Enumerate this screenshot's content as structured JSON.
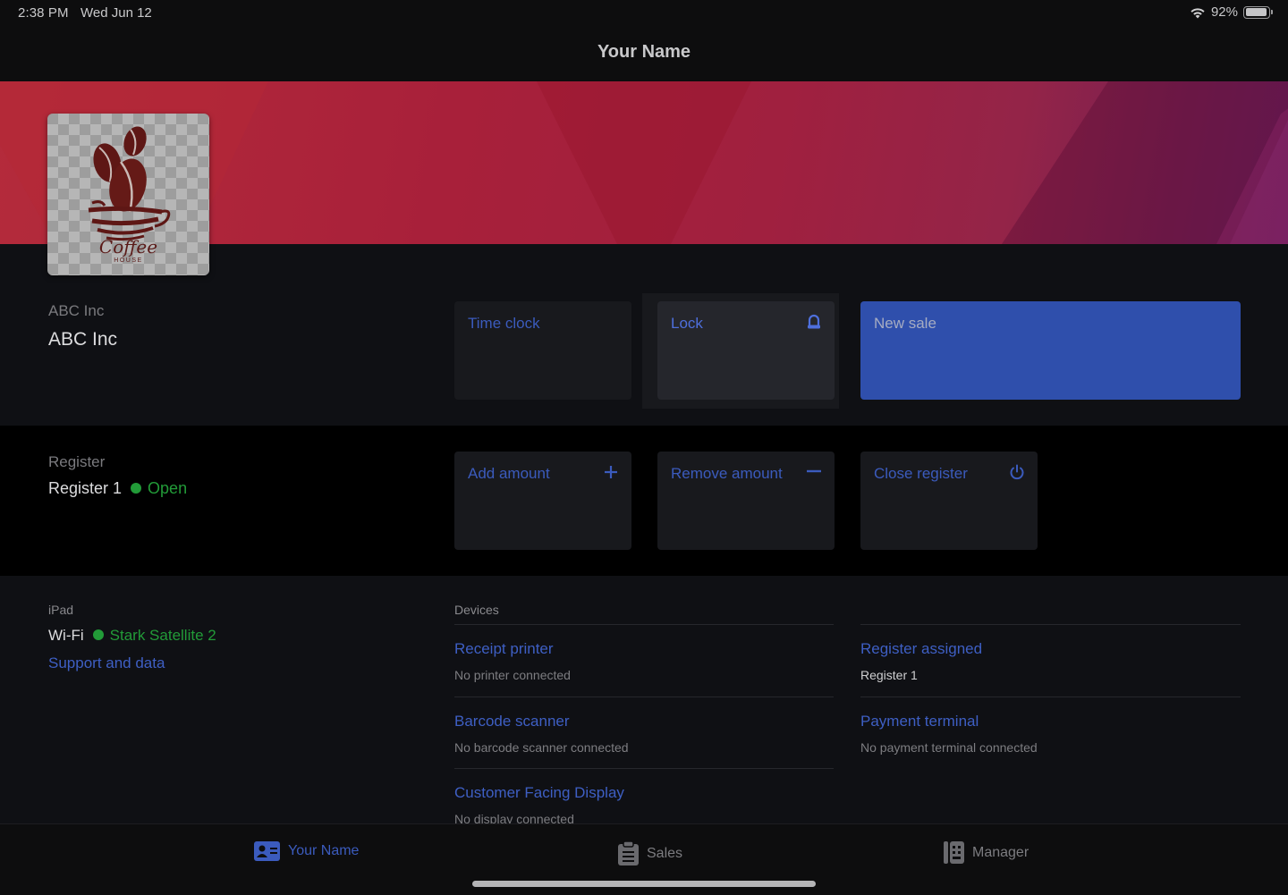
{
  "status_bar": {
    "time": "2:38 PM",
    "date": "Wed Jun 12",
    "wifi_icon": "wifi-icon",
    "battery_percent": "92%",
    "battery_level": 0.92,
    "battery_icon": "battery-icon"
  },
  "nav": {
    "title": "Your Name"
  },
  "logo": {
    "wordmark": "Coffee",
    "subtitle": "HOUSE"
  },
  "business": {
    "label": "ABC Inc",
    "name": "ABC Inc"
  },
  "actions": {
    "time_clock": "Time clock",
    "lock": "Lock",
    "lock_icon": "lock-icon",
    "new_sale": "New sale"
  },
  "register": {
    "label": "Register",
    "name": "Register 1",
    "status": "Open",
    "status_color": "#229b38",
    "actions": {
      "add_amount": "Add amount",
      "add_icon": "plus-icon",
      "remove_amount": "Remove amount",
      "remove_icon": "minus-icon",
      "close_register": "Close register",
      "close_icon": "power-icon"
    }
  },
  "device": {
    "label": "iPad",
    "wifi_label": "Wi-Fi",
    "wifi_network": "Stark Satellite 2",
    "support_link": "Support and data"
  },
  "devices": {
    "header": "Devices",
    "left": [
      {
        "title": "Receipt printer",
        "status": "No printer connected"
      },
      {
        "title": "Barcode scanner",
        "status": "No barcode scanner connected"
      },
      {
        "title": "Customer Facing Display",
        "status": "No display connected"
      }
    ],
    "right": [
      {
        "title": "Register assigned",
        "status": "Register 1"
      },
      {
        "title": "Payment terminal",
        "status": "No payment terminal connected"
      }
    ]
  },
  "tabs": [
    {
      "label": "Your Name",
      "icon": "contact-card-icon",
      "active": true
    },
    {
      "label": "Sales",
      "icon": "clipboard-icon",
      "active": false
    },
    {
      "label": "Manager",
      "icon": "manager-binder-icon",
      "active": false
    }
  ],
  "colors": {
    "accent": "#3b5bbd",
    "primary_button": "#2f4fac",
    "success": "#229b38"
  }
}
